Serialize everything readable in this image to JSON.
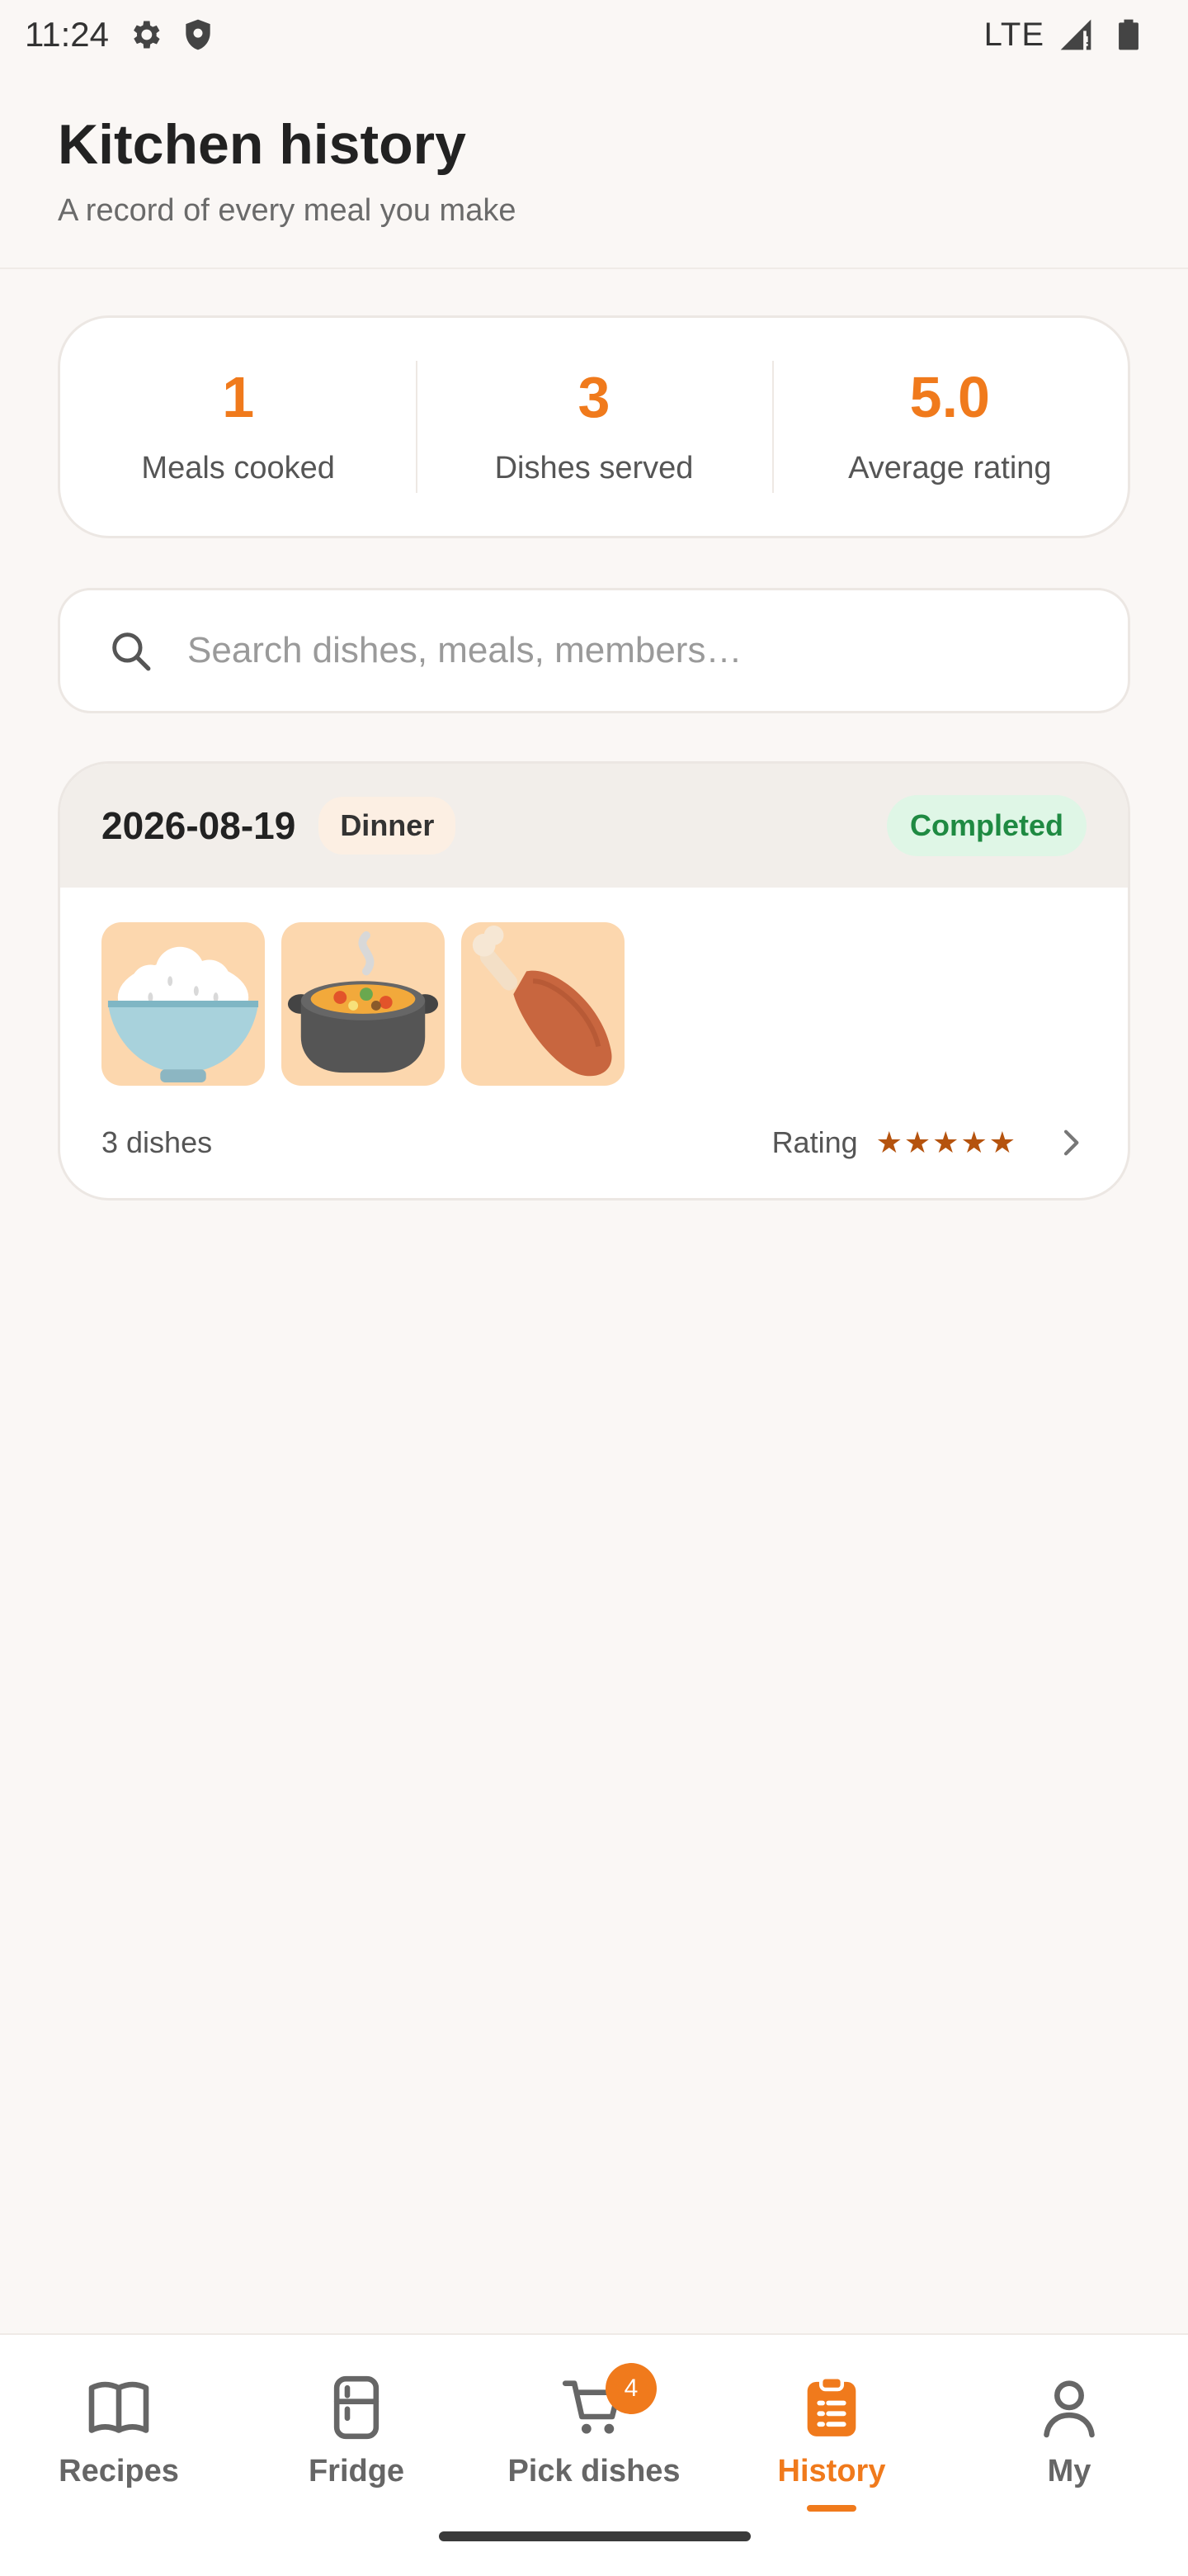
{
  "status_bar": {
    "time": "11:24",
    "network": "LTE"
  },
  "header": {
    "title": "Kitchen history",
    "subtitle": "A record of every meal you make"
  },
  "stats": [
    {
      "value": "1",
      "label": "Meals cooked"
    },
    {
      "value": "3",
      "label": "Dishes served"
    },
    {
      "value": "5.0",
      "label": "Average rating"
    }
  ],
  "search": {
    "placeholder": "Search dishes, meals, members…",
    "value": ""
  },
  "meals": [
    {
      "date": "2026-08-19",
      "type": "Dinner",
      "status": "Completed",
      "dishes": [
        "rice-bowl-icon",
        "stew-pot-icon",
        "chicken-leg-icon"
      ],
      "count": "3 dishes",
      "rating_label": "Rating",
      "stars": "★★★★★",
      "rating_value": 5
    }
  ],
  "nav": {
    "items": [
      {
        "label": "Recipes",
        "icon": "book-icon"
      },
      {
        "label": "Fridge",
        "icon": "fridge-icon"
      },
      {
        "label": "Pick dishes",
        "icon": "cart-icon",
        "badge": "4"
      },
      {
        "label": "History",
        "icon": "clipboard-icon",
        "active": true
      },
      {
        "label": "My",
        "icon": "person-icon"
      }
    ]
  },
  "colors": {
    "accent": "#f07a1c",
    "success": "#1f8a42",
    "background": "#faf7f5"
  }
}
